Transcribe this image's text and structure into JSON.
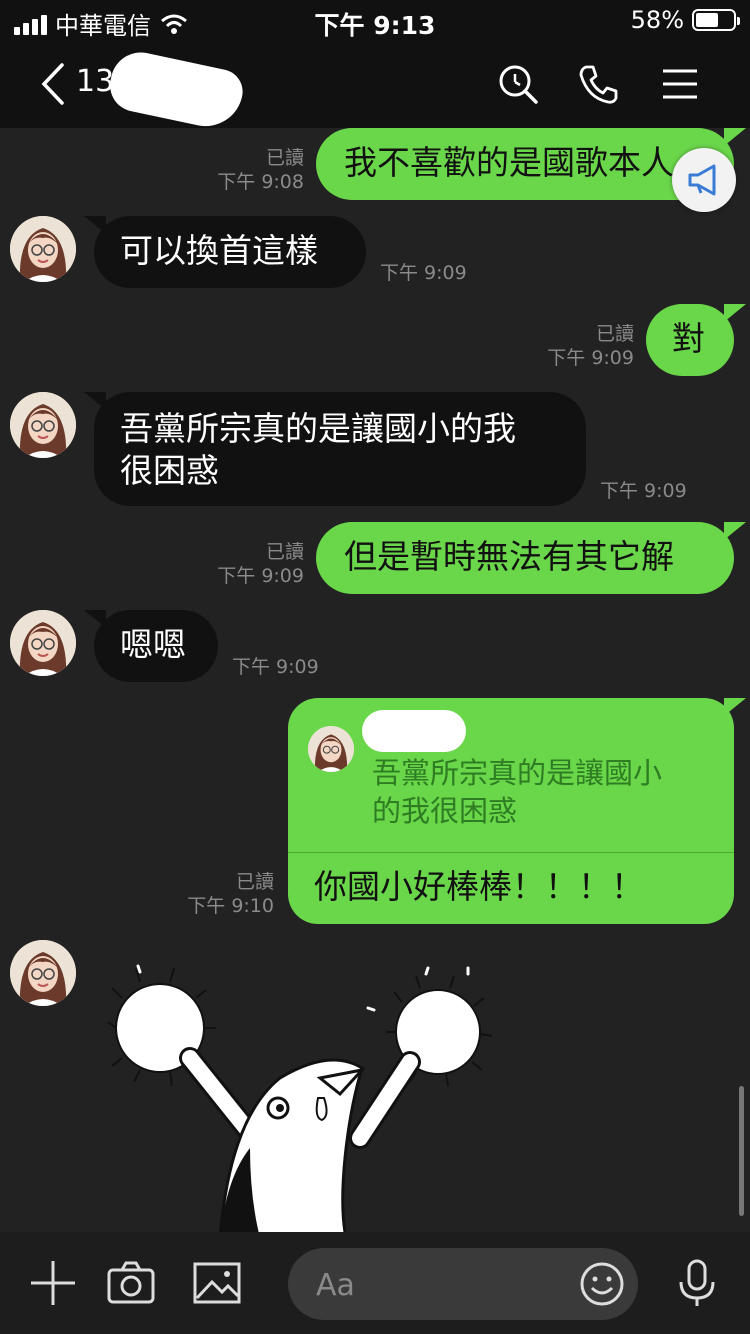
{
  "status": {
    "carrier": "中華電信",
    "time": "下午 9:13",
    "battery": "58%"
  },
  "header": {
    "title": "13"
  },
  "messages": [
    {
      "text": "我不喜歡的是國歌本人",
      "read": "已讀",
      "time": "下午 9:08"
    },
    {
      "text": "可以換首這樣",
      "time": "下午 9:09"
    },
    {
      "text": "對",
      "read": "已讀",
      "time": "下午 9:09"
    },
    {
      "line1": "吾黨所宗真的是讓國小的我",
      "line2": "很困惑",
      "time": "下午 9:09"
    },
    {
      "text": "但是暫時無法有其它解",
      "read": "已讀",
      "time": "下午 9:09"
    },
    {
      "text": "嗯嗯",
      "time": "下午 9:09"
    }
  ],
  "reply": {
    "quote_line1": "吾黨所宗真的是讓國小",
    "quote_line2": "的我很困惑",
    "text": "你國小好棒棒！！！！",
    "read": "已讀",
    "time": "下午 9:10"
  },
  "composer": {
    "placeholder": "Aa"
  }
}
